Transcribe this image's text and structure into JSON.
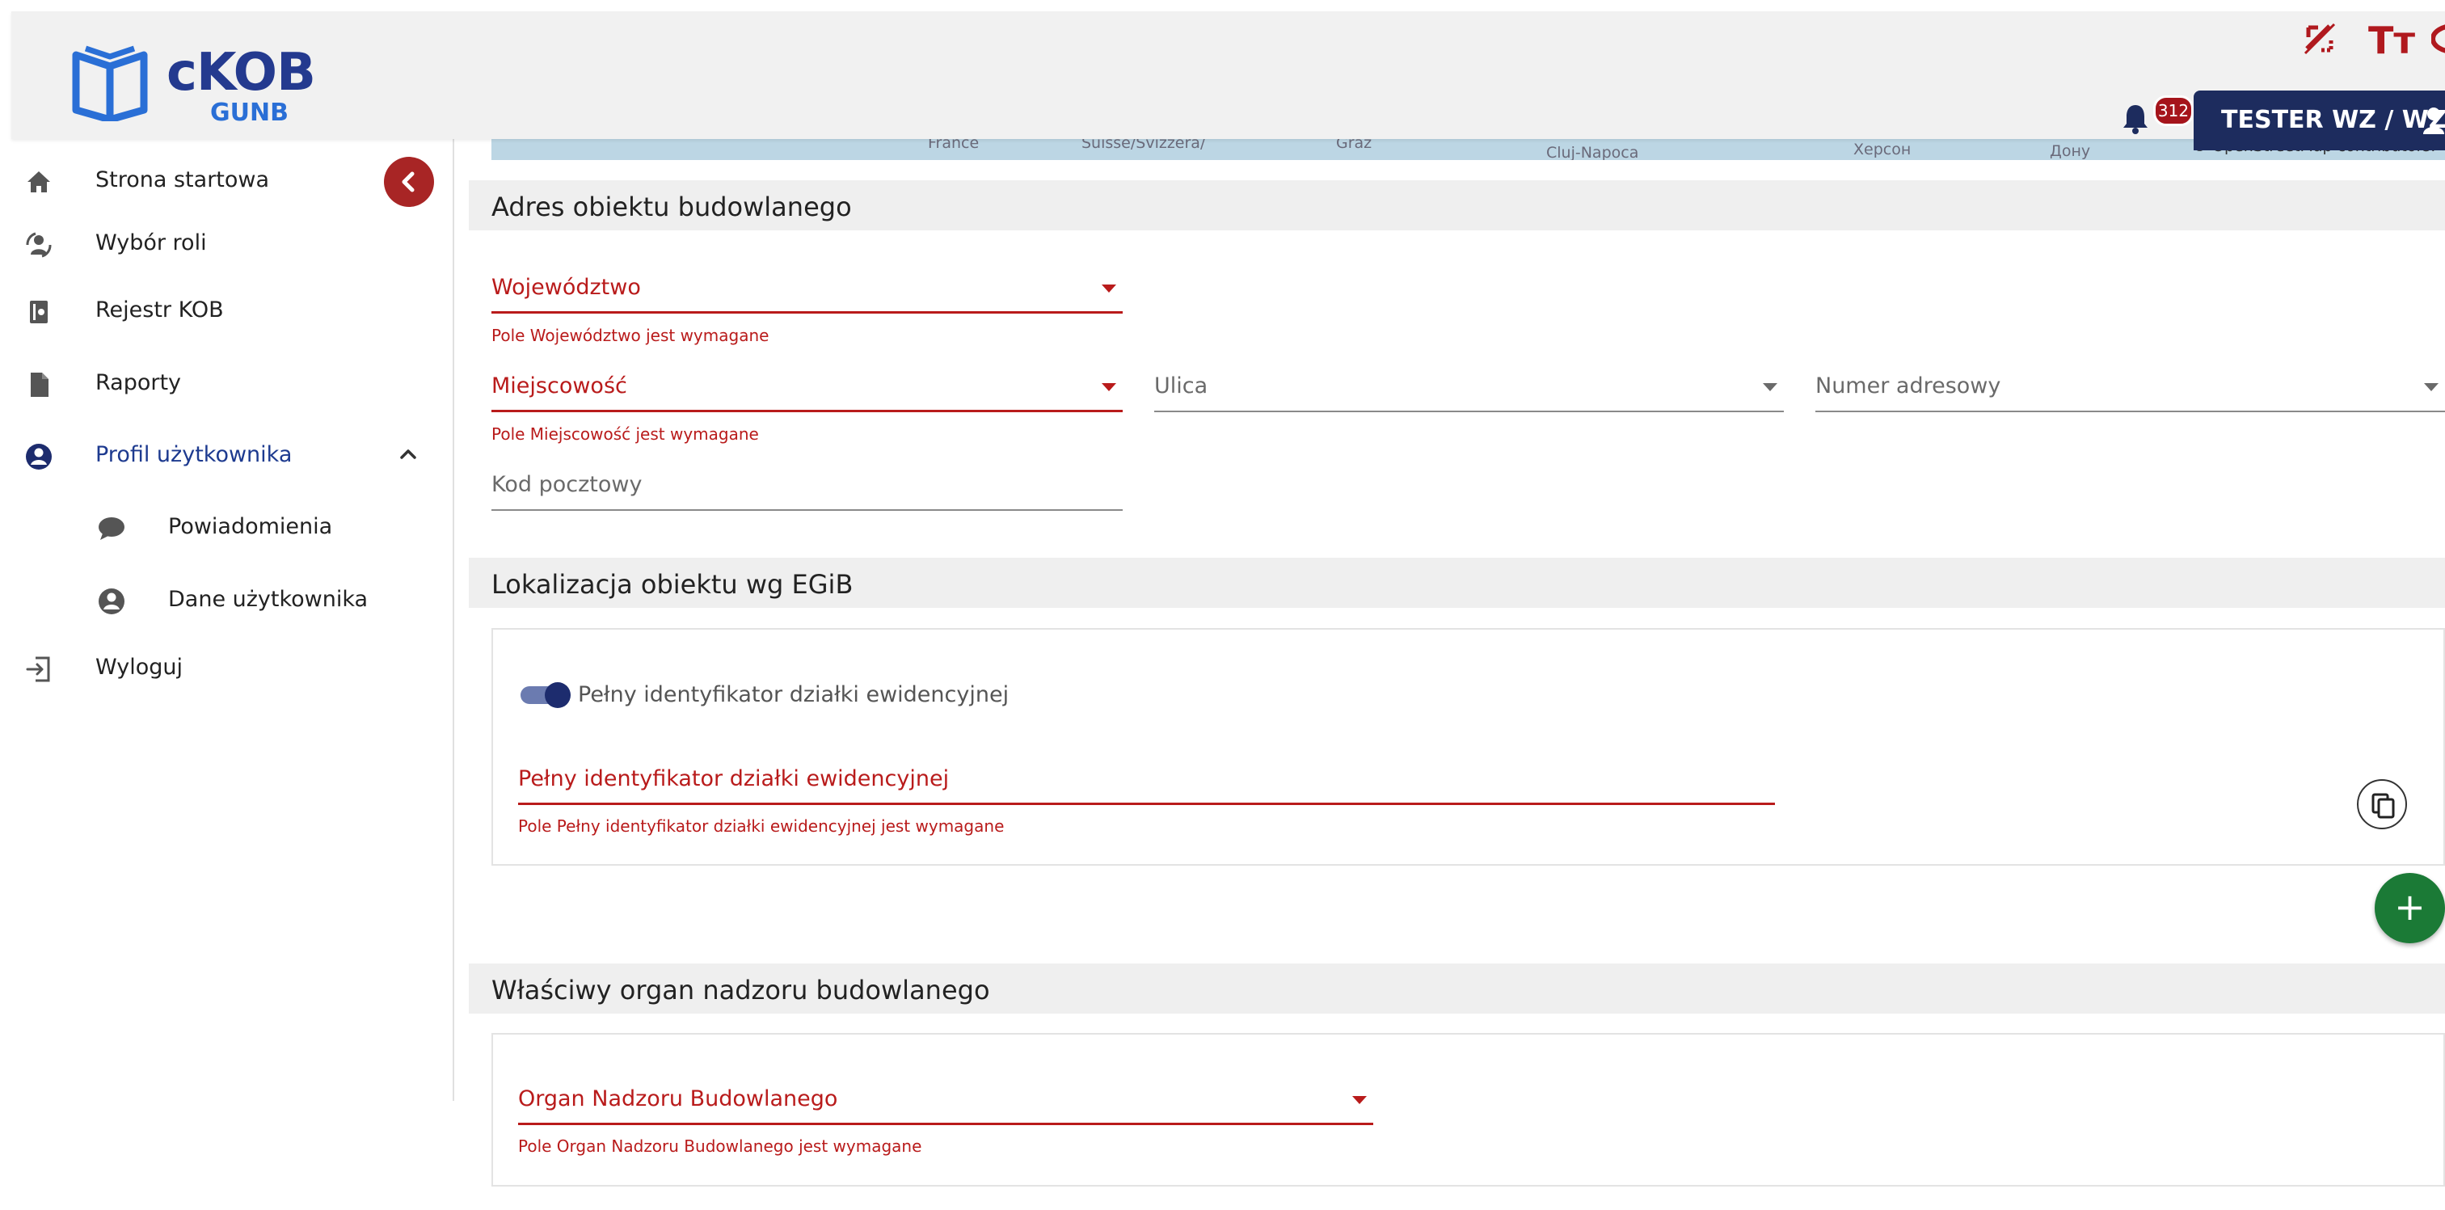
{
  "header": {
    "logo_title": "cKOB",
    "logo_subtitle": "GUNB",
    "notification_count": "312",
    "user_label": "TESTER WZ / WZ",
    "accessibility_icons": [
      "contrast-off-icon",
      "text-size-icon",
      "eye-icon"
    ],
    "text_size_glyph": "Tт"
  },
  "sidebar": {
    "items": [
      {
        "label": "Strona startowa",
        "icon": "home-icon"
      },
      {
        "label": "Wybór roli",
        "icon": "role-switch-icon"
      },
      {
        "label": "Rejestr KOB",
        "icon": "book-icon"
      },
      {
        "label": "Raporty",
        "icon": "document-icon"
      },
      {
        "label": "Profil użytkownika",
        "icon": "user-circle-icon",
        "expanded": true
      },
      {
        "label": "Powiadomienia",
        "icon": "chat-bubble-icon"
      },
      {
        "label": "Dane użytkownika",
        "icon": "user-circle-icon"
      },
      {
        "label": "Wyloguj",
        "icon": "logout-icon"
      }
    ]
  },
  "map": {
    "places": [
      "France",
      "Suisse/Svizzera/",
      "Graz",
      "Cluj-Napoca",
      "Херсон",
      "Дону"
    ],
    "attribution": "© OpenStreetMap contributors."
  },
  "address_section": {
    "title": "Adres obiektu budowlanego",
    "wojewodztwo_label": "Województwo",
    "wojewodztwo_error": "Pole Województwo jest wymagane",
    "miejscowosc_label": "Miejscowość",
    "miejscowosc_error": "Pole Miejscowość jest wymagane",
    "ulica_label": "Ulica",
    "numer_label": "Numer adresowy",
    "kod_label": "Kod pocztowy"
  },
  "egib_section": {
    "title": "Lokalizacja obiektu wg EGiB",
    "toggle_label": "Pełny identyfikator działki ewidencyjnej",
    "toggle_on": true,
    "field_label": "Pełny identyfikator działki ewidencyjnej",
    "field_error": "Pole Pełny identyfikator działki ewidencyjnej jest wymagane",
    "add_label": "+"
  },
  "organ_section": {
    "title": "Właściwy organ nadzoru budowlanego",
    "field_label": "Organ Nadzoru Budowlanego",
    "field_error": "Pole Organ Nadzoru Budowlanego jest wymagane"
  },
  "colors": {
    "accent_red": "#b91b1b",
    "navy": "#1d2c5e",
    "add_green": "#1b7a36",
    "logo_blue": "#2a6fd6"
  }
}
